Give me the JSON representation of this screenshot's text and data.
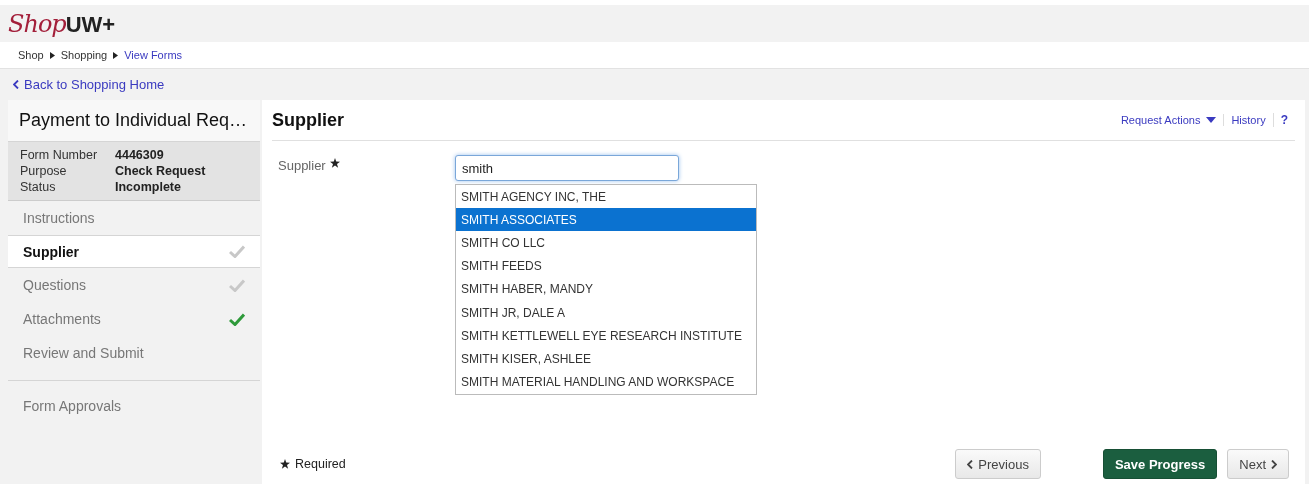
{
  "logo": {
    "script": "Shop",
    "bold": "UW+"
  },
  "breadcrumb": [
    {
      "label": "Shop",
      "kind": "crumb"
    },
    {
      "label": "Shopping",
      "kind": "crumb"
    },
    {
      "label": "View Forms",
      "kind": "link"
    }
  ],
  "back_link": "Back to Shopping Home",
  "form": {
    "title": "Payment to Individual Req…",
    "details": [
      {
        "label": "Form Number",
        "value": "4446309"
      },
      {
        "label": "Purpose",
        "value": "Check Request"
      },
      {
        "label": "Status",
        "value": "Incomplete"
      }
    ]
  },
  "steps": [
    {
      "label": "Instructions",
      "selected": false,
      "kind": "plain"
    },
    {
      "label": "Supplier",
      "selected": true,
      "kind": "pending"
    },
    {
      "label": "Questions",
      "selected": false,
      "kind": "pending"
    },
    {
      "label": "Attachments",
      "selected": false,
      "kind": "done"
    },
    {
      "label": "Review and Submit",
      "selected": false,
      "kind": "plain"
    }
  ],
  "approvals": "Form Approvals",
  "panel": {
    "title": "Supplier",
    "actions": [
      {
        "label": "Request Actions",
        "kind": "menu"
      },
      {
        "label": "History",
        "kind": "link"
      },
      {
        "label": "?",
        "kind": "help"
      }
    ]
  },
  "supplier_field": {
    "label": "Supplier",
    "required": true,
    "value": "smith"
  },
  "suggestions": [
    {
      "label": "SMITH AGENCY INC, THE",
      "selected": false
    },
    {
      "label": "SMITH ASSOCIATES",
      "selected": true
    },
    {
      "label": "SMITH CO LLC",
      "selected": false
    },
    {
      "label": "SMITH FEEDS",
      "selected": false
    },
    {
      "label": "SMITH HABER, MANDY",
      "selected": false
    },
    {
      "label": "SMITH JR, DALE A",
      "selected": false
    },
    {
      "label": "SMITH KETTLEWELL EYE RESEARCH INSTITUTE",
      "selected": false
    },
    {
      "label": "SMITH KISER, ASHLEE",
      "selected": false
    },
    {
      "label": "SMITH MATERIAL HANDLING AND WORKSPACE",
      "selected": false
    }
  ],
  "required_note": "Required",
  "buttons": [
    {
      "label": "Previous",
      "kind": "prev"
    },
    {
      "label": "Save Progress",
      "kind": "primary"
    },
    {
      "label": "Next",
      "kind": "next"
    }
  ]
}
